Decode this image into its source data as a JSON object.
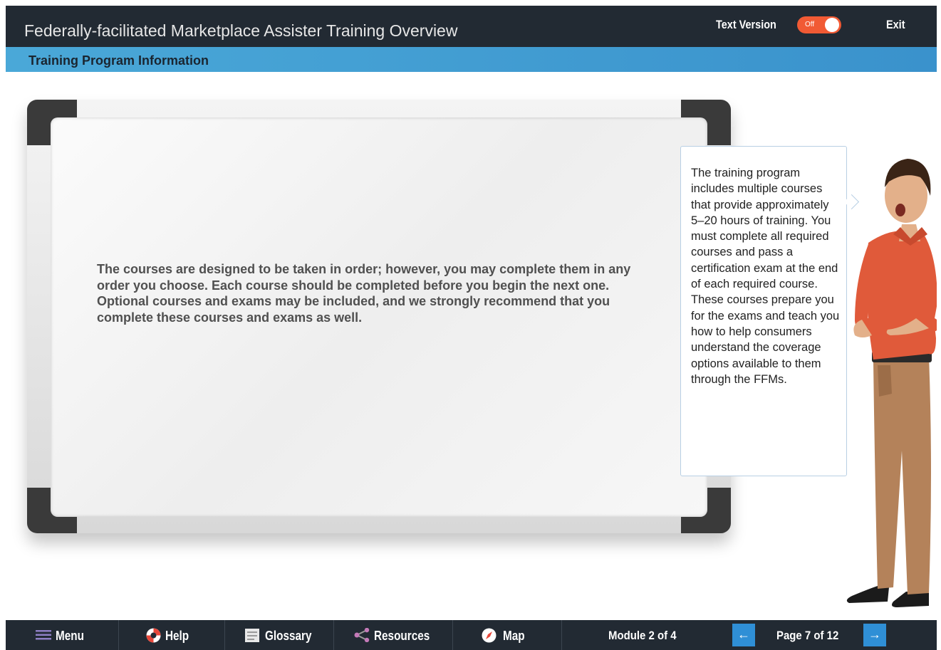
{
  "header": {
    "title": "Federally-facilitated Marketplace Assister Training Overview",
    "text_version_label": "Text Version",
    "toggle_state": "Off",
    "exit_label": "Exit"
  },
  "section": {
    "title": "Training Program Information"
  },
  "board": {
    "text": "The courses are designed to be taken in order; however, you may complete them in any order you choose. Each course should be completed before you begin the next one. Optional courses and exams may be included, and we strongly recommend that you complete these courses and exams as well."
  },
  "bubble": {
    "text": "The training program includes multiple courses that provide approximately 5–20 hours of training. You must complete all required courses and pass a certification exam at the end of each required course. These courses prepare you for the exams and teach you how to help consumers understand the coverage options available to them through the FFMs."
  },
  "footer": {
    "menu_label": "Menu",
    "help_label": "Help",
    "glossary_label": "Glossary",
    "resources_label": "Resources",
    "map_label": "Map",
    "module_indicator": "Module 2 of 4",
    "page_indicator": "Page 7 of 12",
    "prev_arrow": "←",
    "next_arrow": "→"
  },
  "colors": {
    "header_bg": "#222a33",
    "subheader_bg": "#3a92cc",
    "toggle_bg": "#f15a34",
    "nav_arrow_bg": "#2f8fd6"
  },
  "icons": [
    "menu-icon",
    "help-icon",
    "glossary-icon",
    "resources-icon",
    "map-icon"
  ]
}
